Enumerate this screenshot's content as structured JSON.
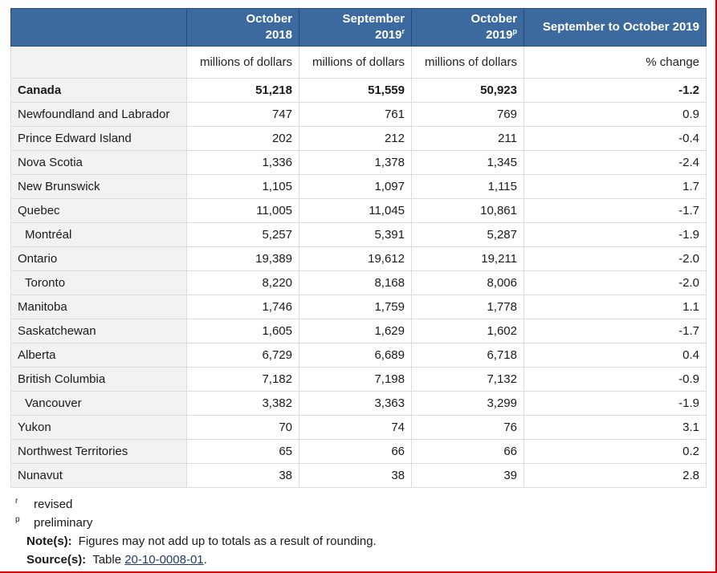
{
  "table": {
    "headers": {
      "col1": {
        "line1": "October",
        "line2": "2018",
        "sup": ""
      },
      "col2": {
        "line1": "September",
        "line2": "2019",
        "sup": "r"
      },
      "col3": {
        "line1": "October",
        "line2": "2019",
        "sup": "p"
      },
      "col4": {
        "line1": "September to October 2019"
      }
    },
    "units": [
      "millions of dollars",
      "millions of dollars",
      "millions of dollars",
      "% change"
    ],
    "rows": [
      {
        "name": "Canada",
        "v1": "51,218",
        "v2": "51,559",
        "v3": "50,923",
        "v4": "-1.2"
      },
      {
        "name": "Newfoundland and Labrador",
        "v1": "747",
        "v2": "761",
        "v3": "769",
        "v4": "0.9"
      },
      {
        "name": "Prince Edward Island",
        "v1": "202",
        "v2": "212",
        "v3": "211",
        "v4": "-0.4"
      },
      {
        "name": "Nova Scotia",
        "v1": "1,336",
        "v2": "1,378",
        "v3": "1,345",
        "v4": "-2.4"
      },
      {
        "name": "New Brunswick",
        "v1": "1,105",
        "v2": "1,097",
        "v3": "1,115",
        "v4": "1.7"
      },
      {
        "name": "Quebec",
        "v1": "11,005",
        "v2": "11,045",
        "v3": "10,861",
        "v4": "-1.7"
      },
      {
        "name": "Montréal",
        "v1": "5,257",
        "v2": "5,391",
        "v3": "5,287",
        "v4": "-1.9"
      },
      {
        "name": "Ontario",
        "v1": "19,389",
        "v2": "19,612",
        "v3": "19,211",
        "v4": "-2.0"
      },
      {
        "name": "Toronto",
        "v1": "8,220",
        "v2": "8,168",
        "v3": "8,006",
        "v4": "-2.0"
      },
      {
        "name": "Manitoba",
        "v1": "1,746",
        "v2": "1,759",
        "v3": "1,778",
        "v4": "1.1"
      },
      {
        "name": "Saskatchewan",
        "v1": "1,605",
        "v2": "1,629",
        "v3": "1,602",
        "v4": "-1.7"
      },
      {
        "name": "Alberta",
        "v1": "6,729",
        "v2": "6,689",
        "v3": "6,718",
        "v4": "0.4"
      },
      {
        "name": "British Columbia",
        "v1": "7,182",
        "v2": "7,198",
        "v3": "7,132",
        "v4": "-0.9"
      },
      {
        "name": "Vancouver",
        "v1": "3,382",
        "v2": "3,363",
        "v3": "3,299",
        "v4": "-1.9"
      },
      {
        "name": "Yukon",
        "v1": "70",
        "v2": "74",
        "v3": "76",
        "v4": "3.1"
      },
      {
        "name": "Northwest Territories",
        "v1": "65",
        "v2": "66",
        "v3": "66",
        "v4": "0.2"
      },
      {
        "name": "Nunavut",
        "v1": "38",
        "v2": "38",
        "v3": "39",
        "v4": "2.8"
      }
    ]
  },
  "footnotes": {
    "revised": {
      "mark": "r",
      "text": "revised"
    },
    "preliminary": {
      "mark": "p",
      "text": "preliminary"
    },
    "note_label": "Note(s):",
    "note_text": "Figures may not add up to totals as a result of rounding.",
    "source_label": "Source(s):",
    "source_prefix": "Table",
    "source_link": "20-10-0008-01",
    "source_suffix": "."
  },
  "colors": {
    "header_bg": "#3d6a9e",
    "stub_bg": "#f2f2f2",
    "frame_border": "#d9000d",
    "link": "#1f3b6b"
  }
}
